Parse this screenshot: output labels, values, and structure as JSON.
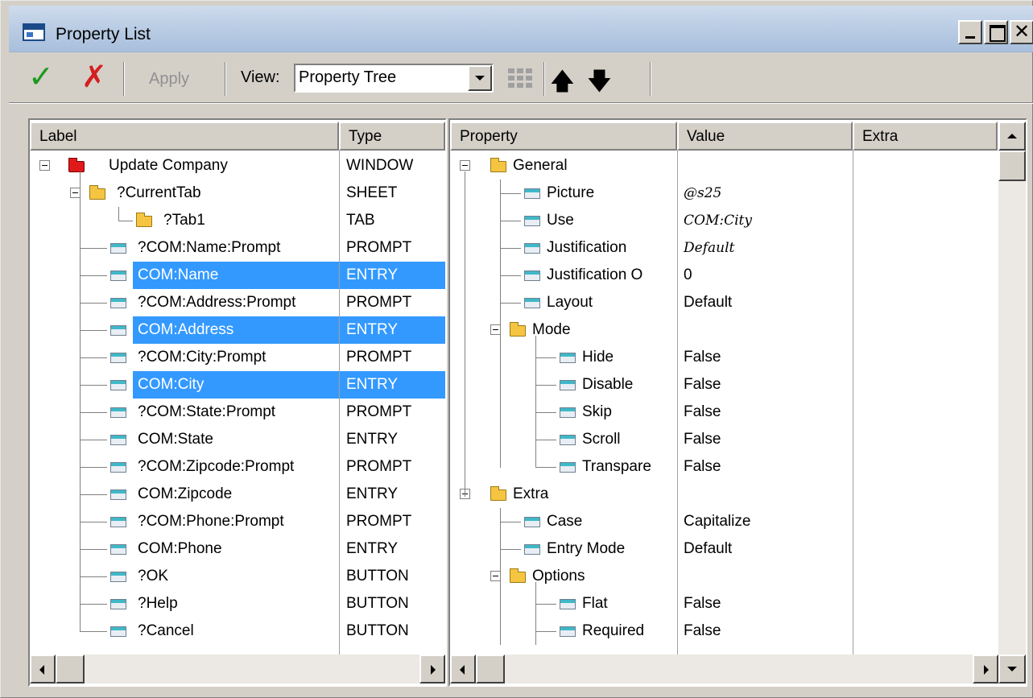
{
  "window": {
    "title": "Property List"
  },
  "toolbar": {
    "ok_icon": "check-icon",
    "cancel_icon": "cross-icon",
    "apply_label": "Apply",
    "view_label": "View:",
    "view_value": "Property Tree",
    "grid_icon": "grid-icon",
    "up_icon": "arrow-up-icon",
    "down_icon": "arrow-down-icon"
  },
  "left_panel": {
    "columns": [
      "Label",
      "Type"
    ],
    "rows": [
      {
        "label": "Update Company",
        "type": "WINDOW",
        "selected": false
      },
      {
        "label": "?CurrentTab",
        "type": "SHEET",
        "selected": false
      },
      {
        "label": "?Tab1",
        "type": "TAB",
        "selected": false
      },
      {
        "label": "?COM:Name:Prompt",
        "type": "PROMPT",
        "selected": false
      },
      {
        "label": "COM:Name",
        "type": "ENTRY",
        "selected": true
      },
      {
        "label": "?COM:Address:Prompt",
        "type": "PROMPT",
        "selected": false
      },
      {
        "label": "COM:Address",
        "type": "ENTRY",
        "selected": true
      },
      {
        "label": "?COM:City:Prompt",
        "type": "PROMPT",
        "selected": false
      },
      {
        "label": "COM:City",
        "type": "ENTRY",
        "selected": true
      },
      {
        "label": "?COM:State:Prompt",
        "type": "PROMPT",
        "selected": false
      },
      {
        "label": "COM:State",
        "type": "ENTRY",
        "selected": false
      },
      {
        "label": "?COM:Zipcode:Prompt",
        "type": "PROMPT",
        "selected": false
      },
      {
        "label": "COM:Zipcode",
        "type": "ENTRY",
        "selected": false
      },
      {
        "label": "?COM:Phone:Prompt",
        "type": "PROMPT",
        "selected": false
      },
      {
        "label": "COM:Phone",
        "type": "ENTRY",
        "selected": false
      },
      {
        "label": "?OK",
        "type": "BUTTON",
        "selected": false
      },
      {
        "label": "?Help",
        "type": "BUTTON",
        "selected": false
      },
      {
        "label": "?Cancel",
        "type": "BUTTON",
        "selected": false
      }
    ]
  },
  "right_panel": {
    "columns": [
      "Property",
      "Value",
      "Extra"
    ],
    "rows": [
      {
        "property": "General",
        "value": "",
        "italic": false
      },
      {
        "property": "Picture",
        "value": "@s25",
        "italic": true
      },
      {
        "property": "Use",
        "value": "COM:City",
        "italic": true
      },
      {
        "property": "Justification",
        "value": "Default",
        "italic": true
      },
      {
        "property": "Justification O",
        "value": "0",
        "italic": false
      },
      {
        "property": "Layout",
        "value": "Default",
        "italic": false
      },
      {
        "property": "Mode",
        "value": "",
        "italic": false
      },
      {
        "property": "Hide",
        "value": "False",
        "italic": false
      },
      {
        "property": "Disable",
        "value": "False",
        "italic": false
      },
      {
        "property": "Skip",
        "value": "False",
        "italic": false
      },
      {
        "property": "Scroll",
        "value": "False",
        "italic": false
      },
      {
        "property": "Transpare",
        "value": "False",
        "italic": false
      },
      {
        "property": "Extra",
        "value": "",
        "italic": false
      },
      {
        "property": "Case",
        "value": "Capitalize",
        "italic": false
      },
      {
        "property": "Entry Mode",
        "value": "Default",
        "italic": false
      },
      {
        "property": "Options",
        "value": "",
        "italic": false
      },
      {
        "property": "Flat",
        "value": "False",
        "italic": false
      },
      {
        "property": "Required",
        "value": "False",
        "italic": false
      }
    ]
  },
  "colors": {
    "selection": "#3399ff",
    "folder": "#f5c542",
    "window_icon": "#e01a1a"
  }
}
